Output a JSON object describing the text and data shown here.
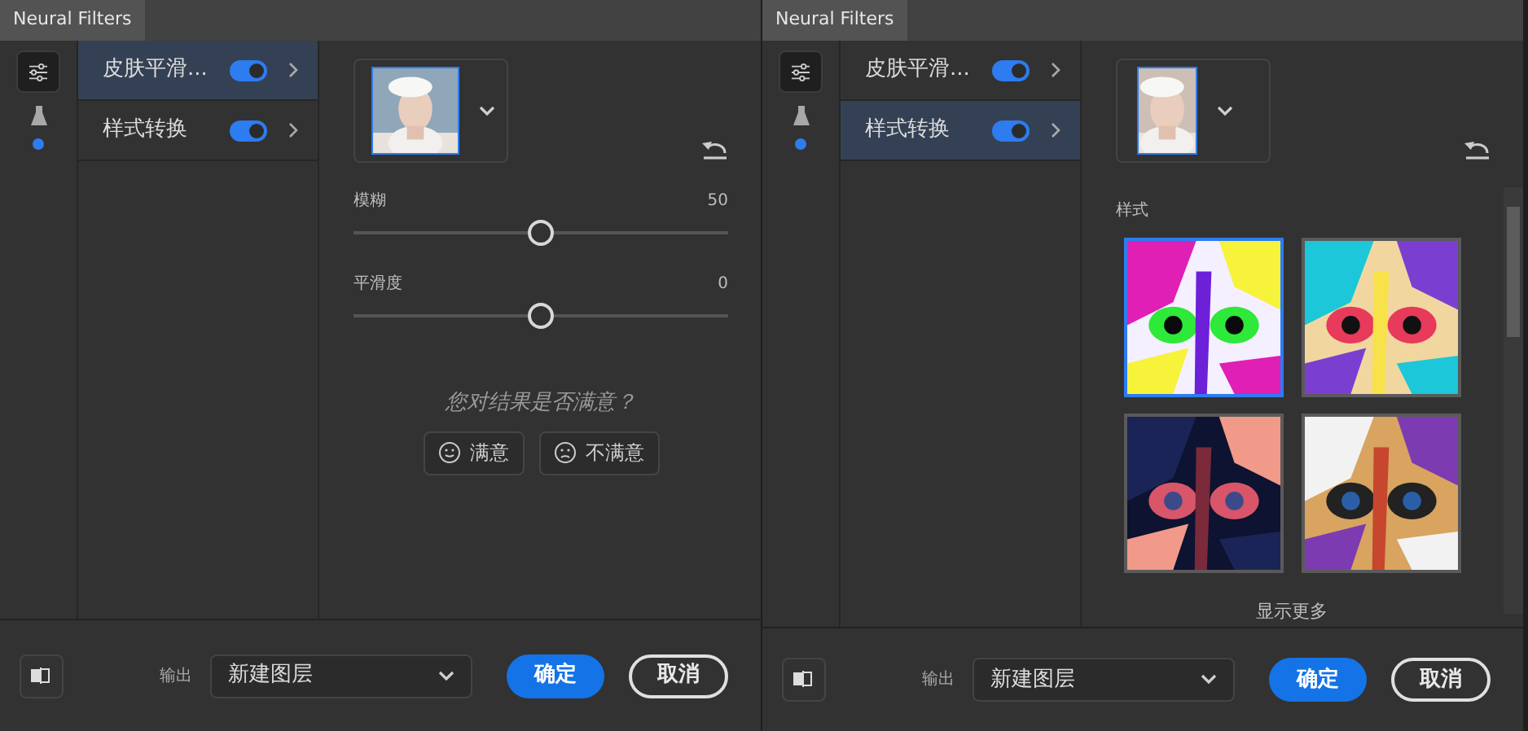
{
  "panels": [
    {
      "tab": "Neural Filters",
      "filters": [
        {
          "name": "皮肤平滑...",
          "on": true,
          "selected": true
        },
        {
          "name": "样式转换",
          "on": true,
          "selected": false
        }
      ],
      "content": {
        "kind": "sliders",
        "sliders": [
          {
            "label": "模糊",
            "reading": "50",
            "level": 0.5
          },
          {
            "label": "平滑度",
            "reading": "0",
            "level": 0.5
          }
        ],
        "question": "您对结果是否满意？",
        "feedback": [
          {
            "kind": "happy",
            "label": "满意"
          },
          {
            "kind": "sad",
            "label": "不满意"
          }
        ]
      },
      "footer": {
        "output_label": "输出",
        "output_value": "新建图层",
        "ok": "确定",
        "cancel": "取消"
      }
    },
    {
      "tab": "Neural Filters",
      "filters": [
        {
          "name": "皮肤平滑...",
          "on": true,
          "selected": false
        },
        {
          "name": "样式转换",
          "on": true,
          "selected": true
        }
      ],
      "content": {
        "kind": "styles",
        "heading": "样式",
        "styles": [
          {
            "kind": "picture",
            "selected": true
          },
          {
            "kind": "picture",
            "selected": false
          },
          {
            "kind": "picture",
            "selected": false
          },
          {
            "kind": "picture",
            "selected": false
          }
        ],
        "more": "显示更多"
      },
      "footer": {
        "output_label": "输出",
        "output_value": "新建图层",
        "ok": "确定",
        "cancel": "取消"
      }
    }
  ]
}
